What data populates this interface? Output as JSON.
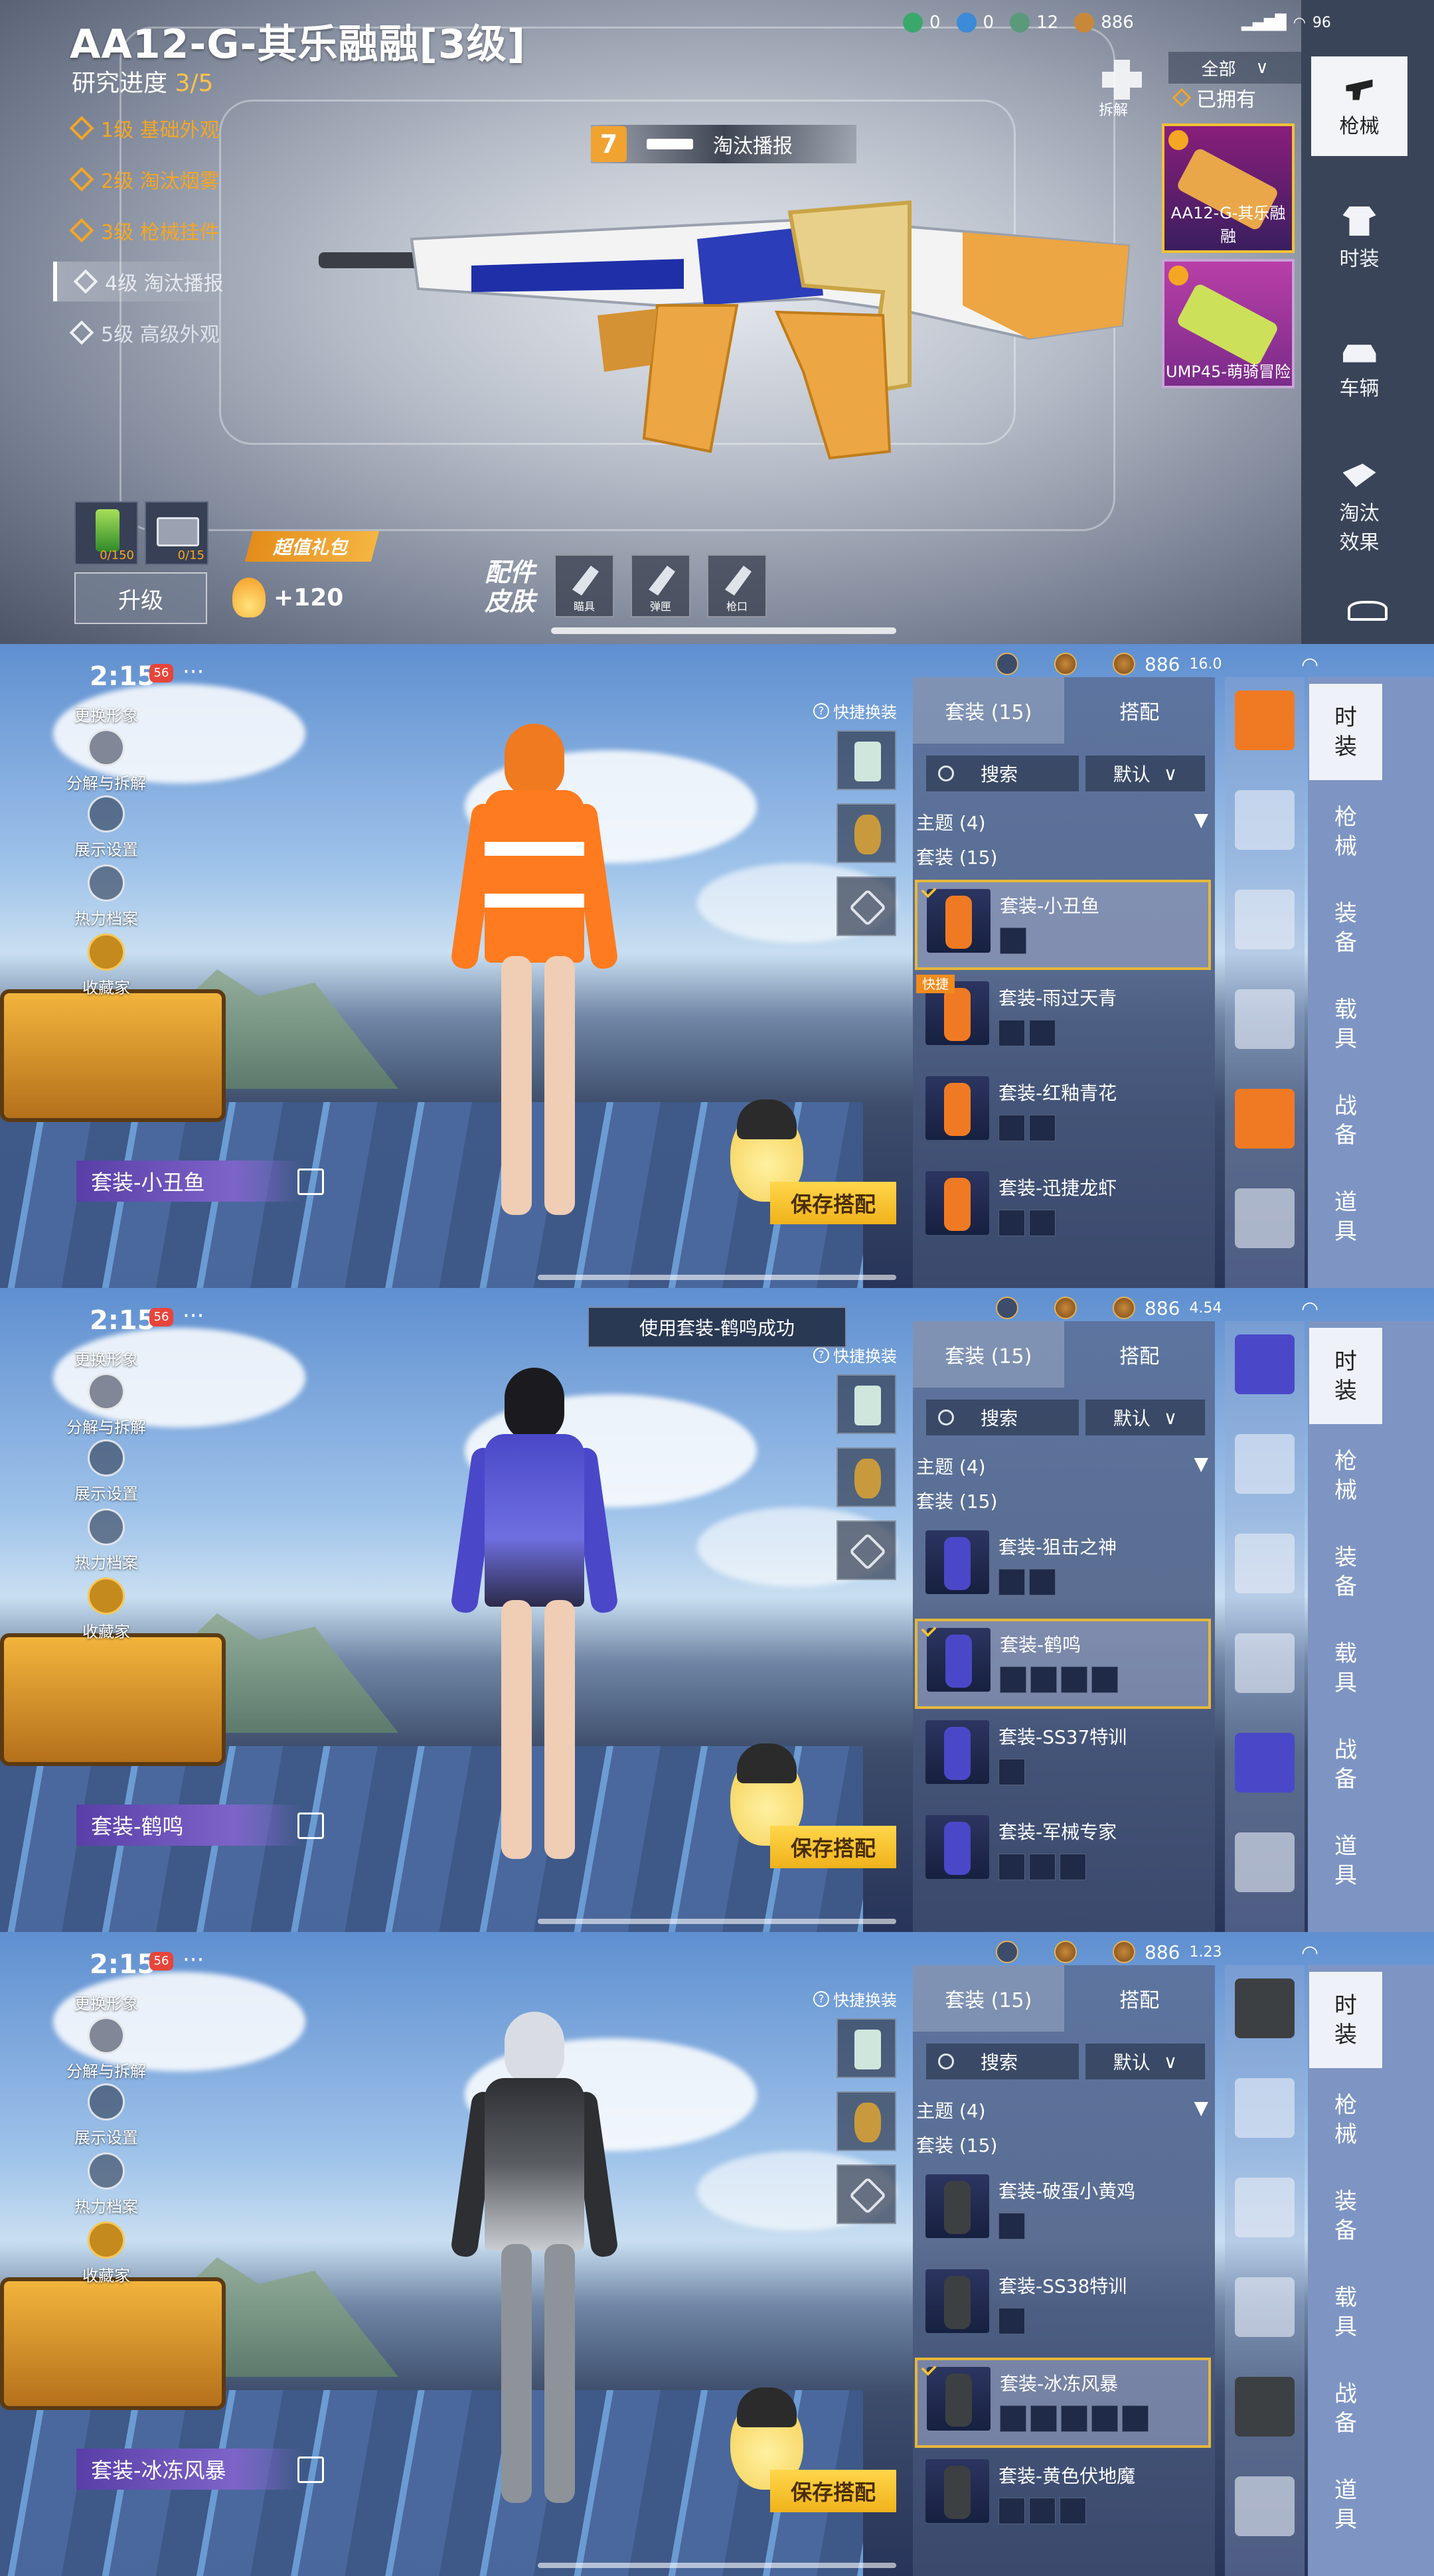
{
  "panel1": {
    "title": "AA12-G-其乐融融[3级]",
    "progress_label": "研究进度",
    "progress_value": "3/5",
    "levels": [
      {
        "label": "1级 基础外观",
        "state": "done"
      },
      {
        "label": "2级 淘汰烟雾",
        "state": "done"
      },
      {
        "label": "3级 枪械挂件",
        "state": "done"
      },
      {
        "label": "4级 淘汰播报",
        "state": "current"
      },
      {
        "label": "5级 高级外观",
        "state": "locked"
      }
    ],
    "banner_number": "7",
    "banner_label": "淘汰播报",
    "dismantle_label": "拆解",
    "filter_label": "全部",
    "owned_label": "已拥有",
    "skin_cards": [
      {
        "name": "AA12-G-其乐融融"
      },
      {
        "name": "UMP45-萌骑冒险"
      }
    ],
    "categories": [
      "枪械",
      "时装",
      "车辆",
      "淘汰效果"
    ],
    "materials": [
      {
        "count": "0/150"
      },
      {
        "count": "0/15"
      }
    ],
    "upgrade_label": "升级",
    "gift_label": "超值礼包",
    "bonus_label": "+120",
    "parts_label_line1": "配件",
    "parts_label_line2": "皮肤",
    "part_buttons": [
      "瞄具",
      "弹匣",
      "枪口"
    ],
    "status": {
      "c1": "0",
      "c2": "0",
      "c3": "12",
      "coins": "886",
      "battery": "96"
    }
  },
  "wardrobe_common": {
    "time": "2:15",
    "notif": "56",
    "menu": "···",
    "tools": [
      "更换形象",
      "分解与拆解",
      "展示设置",
      "热力档案",
      "收藏家"
    ],
    "quick_label": "快捷换装",
    "tab_sets": "套装 (15)",
    "tab_match": "搭配",
    "search_placeholder": "搜索",
    "sort_label": "默认",
    "theme_label": "主题 (4)",
    "set_count": "套装 (15)",
    "save_label": "保存搭配",
    "side_tabs": [
      "时装",
      "枪械",
      "装备",
      "载具",
      "战备",
      "道具"
    ],
    "quick_tag": "快捷",
    "coins": "886"
  },
  "wardrobe1": {
    "nameplate": "套装-小丑鱼",
    "net_speed": "16.0",
    "items": [
      {
        "name": "套装-小丑鱼",
        "selected": true,
        "quick": false,
        "minis": 1
      },
      {
        "name": "套装-雨过天青",
        "selected": false,
        "quick": true,
        "minis": 2
      },
      {
        "name": "套装-红釉青花",
        "selected": false,
        "quick": false,
        "minis": 2
      },
      {
        "name": "套装-迅捷龙虾",
        "selected": false,
        "quick": false,
        "minis": 2
      }
    ]
  },
  "wardrobe2": {
    "nameplate": "套装-鹤鸣",
    "toast": "使用套装-鹤鸣成功",
    "net_speed": "4.54",
    "items": [
      {
        "name": "套装-狙击之神",
        "selected": false,
        "quick": false,
        "minis": 2
      },
      {
        "name": "套装-鹤鸣",
        "selected": true,
        "quick": false,
        "minis": 4
      },
      {
        "name": "套装-SS37特训",
        "selected": false,
        "quick": false,
        "minis": 1
      },
      {
        "name": "套装-军械专家",
        "selected": false,
        "quick": false,
        "minis": 3
      }
    ]
  },
  "wardrobe3": {
    "nameplate": "套装-冰冻风暴",
    "net_speed": "1.23",
    "items": [
      {
        "name": "套装-破蛋小黄鸡",
        "selected": false,
        "quick": false,
        "minis": 1
      },
      {
        "name": "套装-SS38特训",
        "selected": false,
        "quick": false,
        "minis": 1
      },
      {
        "name": "套装-冰冻风暴",
        "selected": true,
        "quick": false,
        "minis": 5
      },
      {
        "name": "套装-黄色伏地魔",
        "selected": false,
        "quick": false,
        "minis": 3
      }
    ]
  },
  "colors": {
    "accent": "#f5a623",
    "save": "#f0b21b",
    "select_border": "#e5b73b",
    "nameplate": "#5a3ea8"
  }
}
